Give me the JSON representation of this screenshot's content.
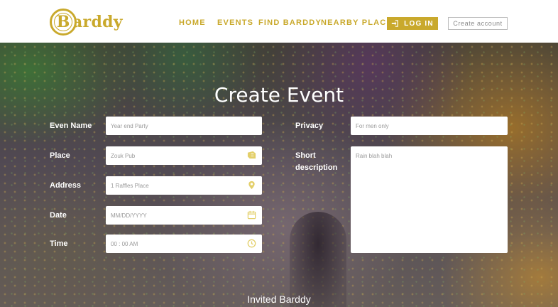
{
  "brand": {
    "name": "arddy",
    "initial": "B"
  },
  "nav": {
    "items": [
      {
        "label": "HOME"
      },
      {
        "label": "EVENTS"
      },
      {
        "label": "FIND BARDDY"
      },
      {
        "label": "NEARBY PLACES"
      }
    ],
    "login_label": "LOG IN",
    "create_account_label": "Create account"
  },
  "form": {
    "title": "Create Event",
    "event_name": {
      "label": "Even Name",
      "placeholder": "Year end Party"
    },
    "place": {
      "label": "Place",
      "placeholder": "Zouk Pub"
    },
    "address": {
      "label": "Address",
      "placeholder": "1 Raffles Place"
    },
    "date": {
      "label": "Date",
      "placeholder": "MM/DD/YYYY"
    },
    "time": {
      "label": "Time",
      "placeholder": "00 : 00 AM"
    },
    "privacy": {
      "label": "Privacy",
      "placeholder": "For men only"
    },
    "description": {
      "label_line1": "Short",
      "label_line2": "description",
      "placeholder": "Rain blah blah"
    }
  },
  "invited_heading": "Invited Barddy",
  "colors": {
    "accent": "#c9a92c",
    "icon": "#e3cf6a"
  },
  "icons": {
    "place": "ticket-icon",
    "address": "map-pin-icon",
    "date": "calendar-icon",
    "time": "clock-icon",
    "login": "login-icon"
  }
}
